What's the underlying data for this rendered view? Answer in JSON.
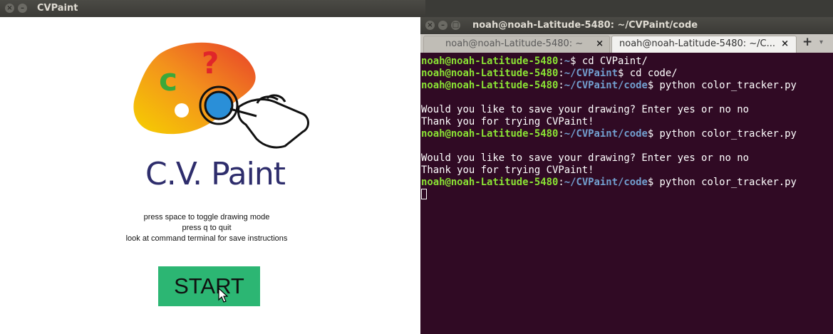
{
  "left_window": {
    "title": "CVPaint",
    "app_title": "C.V. Paint",
    "instructions": [
      "press space to toggle drawing mode",
      "press q to quit",
      "look at command terminal for save instructions"
    ],
    "start_label": "START",
    "logo_letters": {
      "c": "c",
      "question": "?"
    }
  },
  "terminal_window": {
    "title": "noah@noah-Latitude-5480: ~/CVPaint/code",
    "tabs": [
      {
        "label": "noah@noah-Latitude-5480: ~",
        "active": false,
        "close": "×"
      },
      {
        "label": "noah@noah-Latitude-5480: ~/C...",
        "active": true,
        "close": "×"
      }
    ],
    "add_tab": "+",
    "menu": "▾",
    "colors": {
      "background": "#300a24",
      "user": "#8ae234",
      "path": "#729fcf"
    },
    "lines": [
      {
        "user": "noah@noah-Latitude-5480",
        "sep": ":",
        "path": "~",
        "cmd": "$ cd CVPaint/"
      },
      {
        "user": "noah@noah-Latitude-5480",
        "sep": ":",
        "path": "~/CVPaint",
        "cmd": "$ cd code/"
      },
      {
        "user": "noah@noah-Latitude-5480",
        "sep": ":",
        "path": "~/CVPaint/code",
        "cmd": "$ python color_tracker.py"
      },
      {
        "text": ""
      },
      {
        "text": "Would you like to save your drawing? Enter yes or no no"
      },
      {
        "text": "Thank you for trying CVPaint!"
      },
      {
        "user": "noah@noah-Latitude-5480",
        "sep": ":",
        "path": "~/CVPaint/code",
        "cmd": "$ python color_tracker.py"
      },
      {
        "text": ""
      },
      {
        "text": "Would you like to save your drawing? Enter yes or no no"
      },
      {
        "text": "Thank you for trying CVPaint!"
      },
      {
        "user": "noah@noah-Latitude-5480",
        "sep": ":",
        "path": "~/CVPaint/code",
        "cmd": "$ python color_tracker.py"
      },
      {
        "text": ""
      }
    ]
  }
}
